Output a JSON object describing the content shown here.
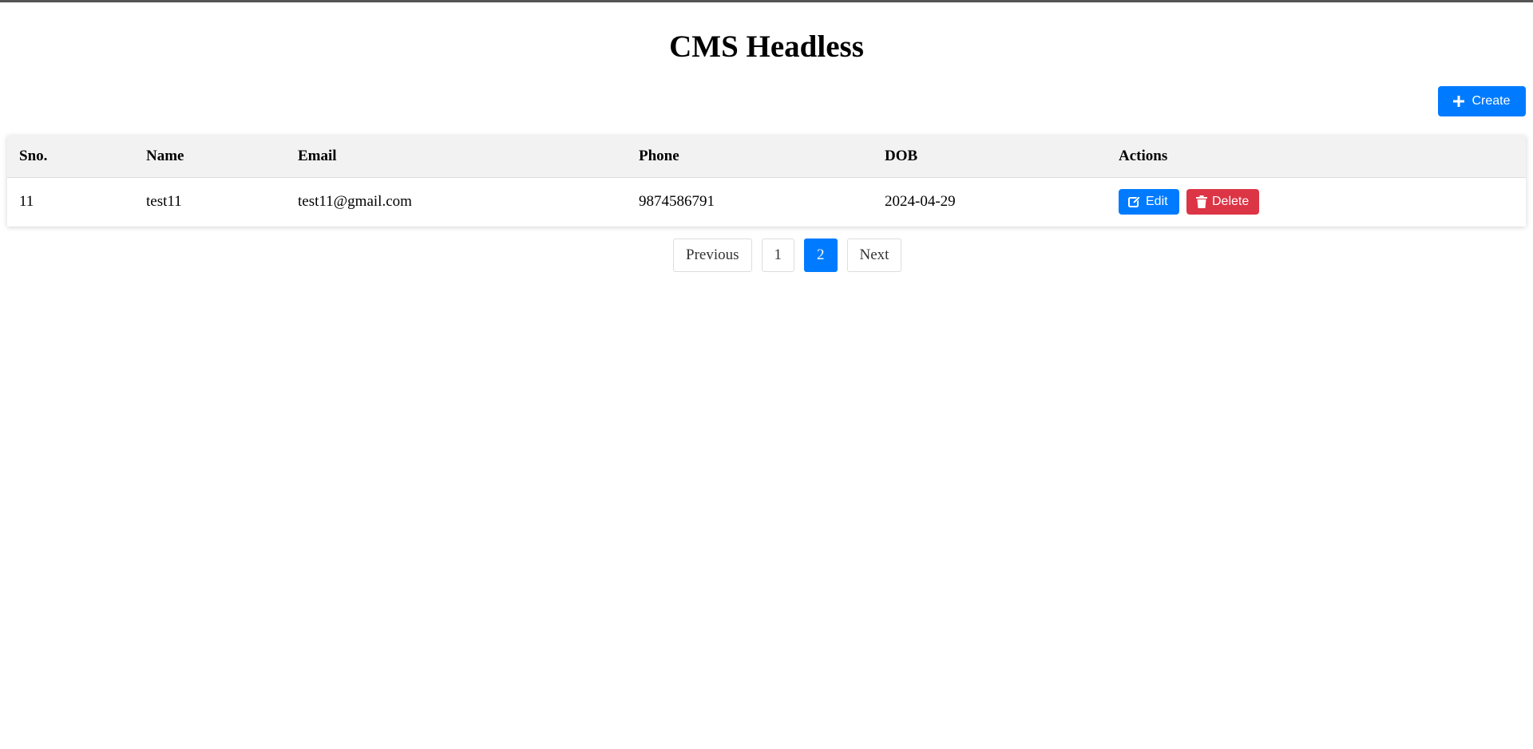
{
  "page": {
    "title": "CMS Headless"
  },
  "toolbar": {
    "create_label": "Create",
    "create_icon": "plus-icon"
  },
  "table": {
    "columns": [
      "Sno.",
      "Name",
      "Email",
      "Phone",
      "DOB",
      "Actions"
    ],
    "rows": [
      {
        "sno": "11",
        "name": "test11",
        "email": "test11@gmail.com",
        "phone": "9874586791",
        "dob": "2024-04-29",
        "edit_label": "Edit",
        "delete_label": "Delete"
      }
    ]
  },
  "pagination": {
    "previous_label": "Previous",
    "pages": [
      "1",
      "2"
    ],
    "current_page": "2",
    "next_label": "Next"
  },
  "colors": {
    "primary": "#007bff",
    "danger": "#dc3545",
    "header_bg": "#f2f2f2"
  }
}
